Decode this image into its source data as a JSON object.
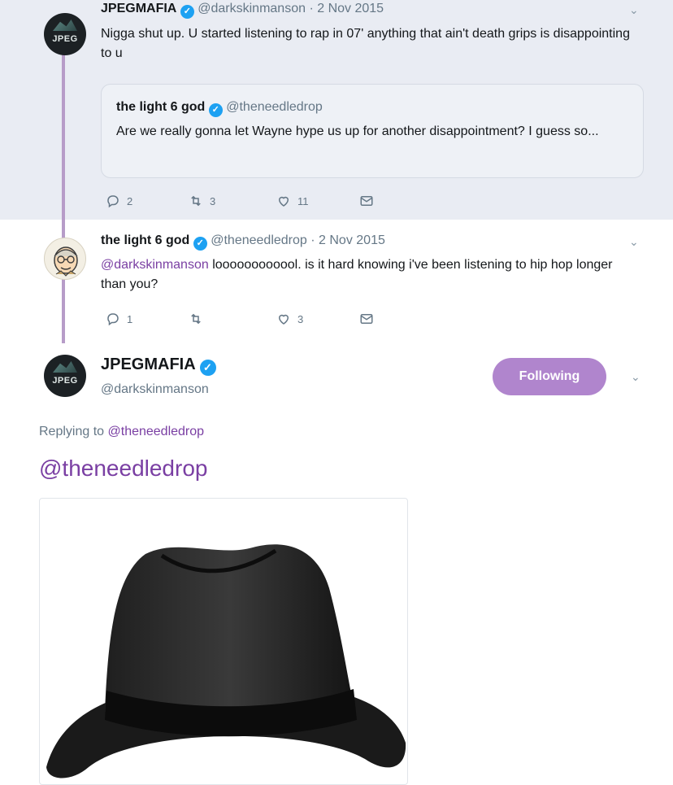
{
  "thread": {
    "tweet1": {
      "name": "JPEGMAFIA",
      "handle": "@darkskinmanson",
      "date": "· 2 Nov 2015",
      "text": "Nigga shut up. U started listening to rap in 07' anything that ain't death grips is disappointing to u",
      "avatar_label": "JPEG",
      "quote": {
        "name": "the light 6 god",
        "handle": "@theneedledrop",
        "text": "Are we really gonna let Wayne hype us up for another disappointment? I guess so..."
      },
      "reply_count": "2",
      "retweet_count": "3",
      "like_count": "11"
    },
    "tweet2": {
      "name": "the light 6 god",
      "handle": "@theneedledrop",
      "date": "· 2 Nov 2015",
      "mention": "@darkskinmanson",
      "text": " loooooooooool. is it hard knowing i've been listening to hip hop longer than you?",
      "reply_count": "1",
      "like_count": "3"
    }
  },
  "main_tweet": {
    "name": "JPEGMAFIA",
    "handle": "@darkskinmanson",
    "avatar_label": "JPEG",
    "follow_label": "Following",
    "replying_prefix": "Replying to ",
    "replying_handle": "@theneedledrop",
    "text": "@theneedledrop",
    "media": "black-fedora-hat-image"
  },
  "colors": {
    "accent_purple": "#b085cd",
    "mention_purple": "#7a3fa3",
    "verified_blue": "#1da1f2",
    "thread_bg": "#e9ecf3"
  }
}
